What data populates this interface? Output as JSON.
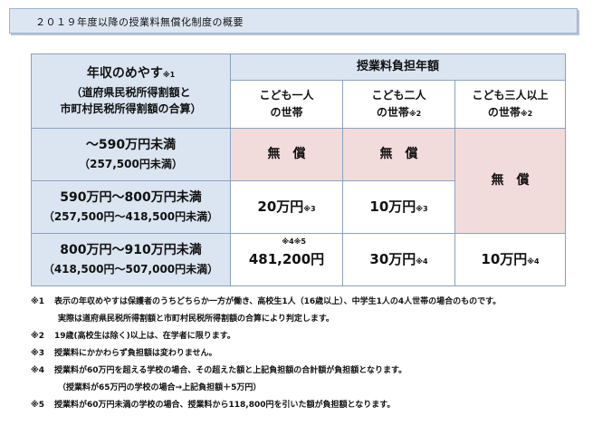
{
  "title": "２０１９年度以降の授業料無償化制度の概要",
  "table": {
    "income_header_main": "年収のめやす",
    "income_header_note": "※1",
    "income_header_sub1": "（道府県民税所得割額と",
    "income_header_sub2": "市町村民税所得割額の合算）",
    "burden_header": "授業料負担年額",
    "col1_line1": "こども一人",
    "col1_line2": "の世帯",
    "col2_line1": "こども二人",
    "col2_line2": "の世帯",
    "col2_note": "※2",
    "col3_line1": "こども三人以上",
    "col3_line2": "の世帯",
    "col3_note": "※2",
    "rows": [
      {
        "income": "～590万円未満",
        "income_sub": "（257,500円未満）",
        "col1": "無　償",
        "col2": "無　償"
      },
      {
        "income": "590万円～800万円未満",
        "income_sub": "（257,500円～418,500円未満）",
        "col1": "20万円",
        "col1_note": "※3",
        "col2": "10万円",
        "col2_note": "※3"
      },
      {
        "income": "800万円～910万円未満",
        "income_sub": "（418,500円～507,000円未満）",
        "col1": "481,200円",
        "col1_note": "※4※5",
        "col2": "30万円",
        "col2_note": "※4",
        "col3": "10万円",
        "col3_note": "※4"
      }
    ],
    "col3_merged": "無　償"
  },
  "notes": [
    {
      "mark": "※1",
      "text": "表示の年収めやすは保護者のうちどちらか一方が働き、高校生1人（16歳以上）、中学生1人の4人世帯の場合のものです。"
    },
    {
      "mark": "",
      "text": "実際は道府県民税所得割額と市町村民税所得割額の合算により判定します。",
      "indent": true
    },
    {
      "mark": "※2",
      "text": "19歳(高校生は除く)以上は、在学者に限ります。"
    },
    {
      "mark": "※3",
      "text": "授業料にかかわらず負担額は変わりません。"
    },
    {
      "mark": "※4",
      "text": "授業料が60万円を超える学校の場合、その超えた額と上記負担額の合計額が負担額となります。"
    },
    {
      "mark": "",
      "text": "（授業料が65万円の学校の場合→上記負担額＋5万円）",
      "indent": true
    },
    {
      "mark": "※5",
      "text": "授業料が60万円未満の学校の場合、授業料から118,800円を引いた額が負担額となります。"
    }
  ]
}
